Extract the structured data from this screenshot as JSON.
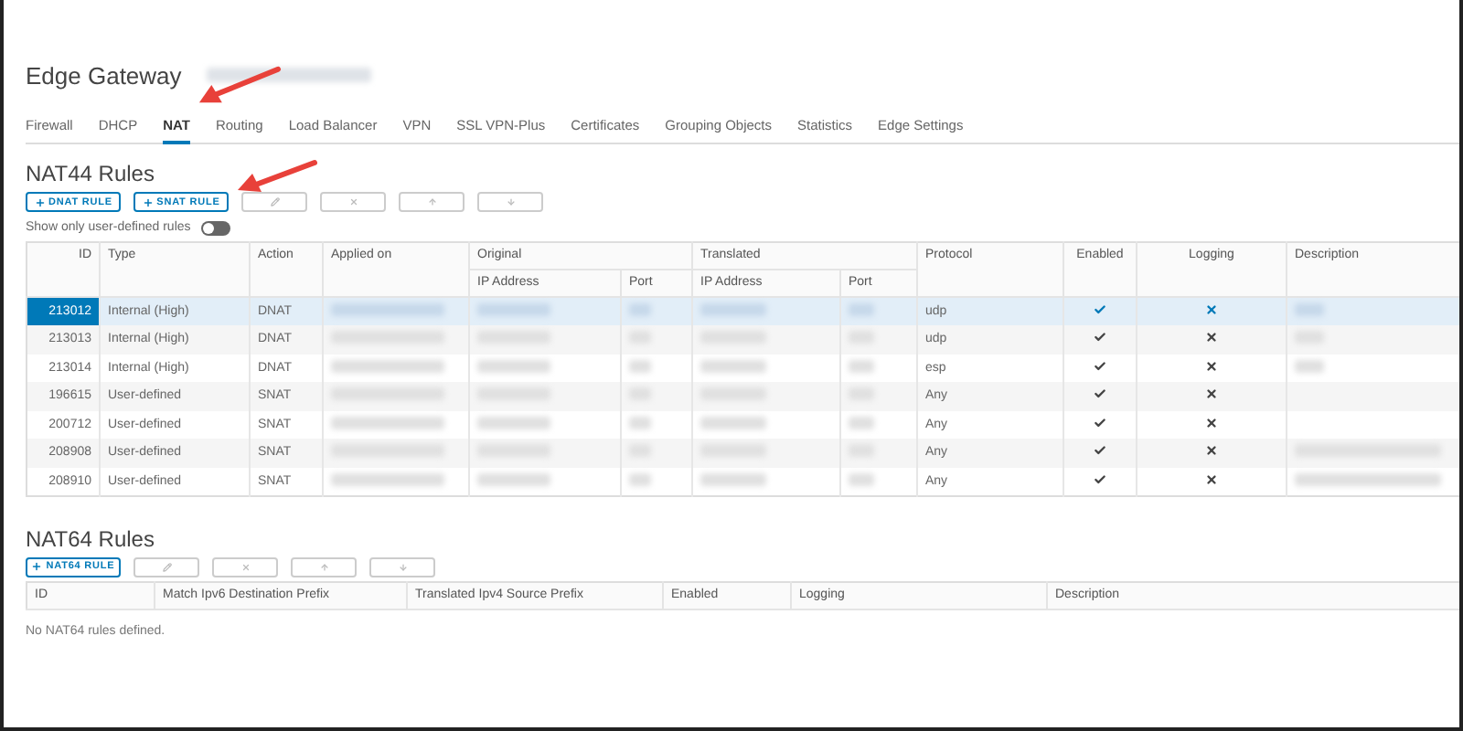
{
  "page": {
    "title": "Edge Gateway"
  },
  "tabs": [
    {
      "label": "Firewall",
      "selected": false
    },
    {
      "label": "DHCP",
      "selected": false
    },
    {
      "label": "NAT",
      "selected": true
    },
    {
      "label": "Routing",
      "selected": false
    },
    {
      "label": "Load Balancer",
      "selected": false
    },
    {
      "label": "VPN",
      "selected": false
    },
    {
      "label": "SSL VPN-Plus",
      "selected": false
    },
    {
      "label": "Certificates",
      "selected": false
    },
    {
      "label": "Grouping Objects",
      "selected": false
    },
    {
      "label": "Statistics",
      "selected": false
    },
    {
      "label": "Edge Settings",
      "selected": false
    }
  ],
  "nat44": {
    "title": "NAT44 Rules",
    "toolbar": [
      {
        "kind": "add",
        "label": "DNAT RULE",
        "disabled": false
      },
      {
        "kind": "add",
        "label": "SNAT RULE",
        "disabled": false
      },
      {
        "kind": "edit",
        "disabled": true
      },
      {
        "kind": "delete",
        "disabled": true
      },
      {
        "kind": "up",
        "disabled": true
      },
      {
        "kind": "down",
        "disabled": true
      }
    ],
    "filter": {
      "label": "Show only user-defined rules",
      "on": false
    },
    "column_groups": [
      "Original",
      "Translated"
    ],
    "columns": [
      "ID",
      "Type",
      "Action",
      "Applied on",
      "IP Address",
      "Port",
      "IP Address",
      "Port",
      "Protocol",
      "Enabled",
      "Logging",
      "Description"
    ],
    "rows": [
      {
        "id": "213012",
        "type": "Internal (High)",
        "action": "DNAT",
        "protocol": "udp",
        "enabled": true,
        "logging": false,
        "selected": true,
        "has_description": true
      },
      {
        "id": "213013",
        "type": "Internal (High)",
        "action": "DNAT",
        "protocol": "udp",
        "enabled": true,
        "logging": false,
        "selected": false,
        "has_description": true
      },
      {
        "id": "213014",
        "type": "Internal (High)",
        "action": "DNAT",
        "protocol": "esp",
        "enabled": true,
        "logging": false,
        "selected": false,
        "has_description": true
      },
      {
        "id": "196615",
        "type": "User-defined",
        "action": "SNAT",
        "protocol": "Any",
        "enabled": true,
        "logging": false,
        "selected": false,
        "has_description": false
      },
      {
        "id": "200712",
        "type": "User-defined",
        "action": "SNAT",
        "protocol": "Any",
        "enabled": true,
        "logging": false,
        "selected": false,
        "has_description": false
      },
      {
        "id": "208908",
        "type": "User-defined",
        "action": "SNAT",
        "protocol": "Any",
        "enabled": true,
        "logging": false,
        "selected": false,
        "has_description": true
      },
      {
        "id": "208910",
        "type": "User-defined",
        "action": "SNAT",
        "protocol": "Any",
        "enabled": true,
        "logging": false,
        "selected": false,
        "has_description": true
      }
    ]
  },
  "nat64": {
    "title": "NAT64 Rules",
    "toolbar": [
      {
        "kind": "add",
        "label": "NAT64 RULE",
        "disabled": false
      },
      {
        "kind": "edit",
        "disabled": true
      },
      {
        "kind": "delete",
        "disabled": true
      },
      {
        "kind": "up",
        "disabled": true
      },
      {
        "kind": "down",
        "disabled": true
      }
    ],
    "columns": [
      "ID",
      "Match Ipv6 Destination Prefix",
      "Translated Ipv4 Source Prefix",
      "Enabled",
      "Logging",
      "Description"
    ],
    "empty_message": "No NAT64 rules defined."
  }
}
